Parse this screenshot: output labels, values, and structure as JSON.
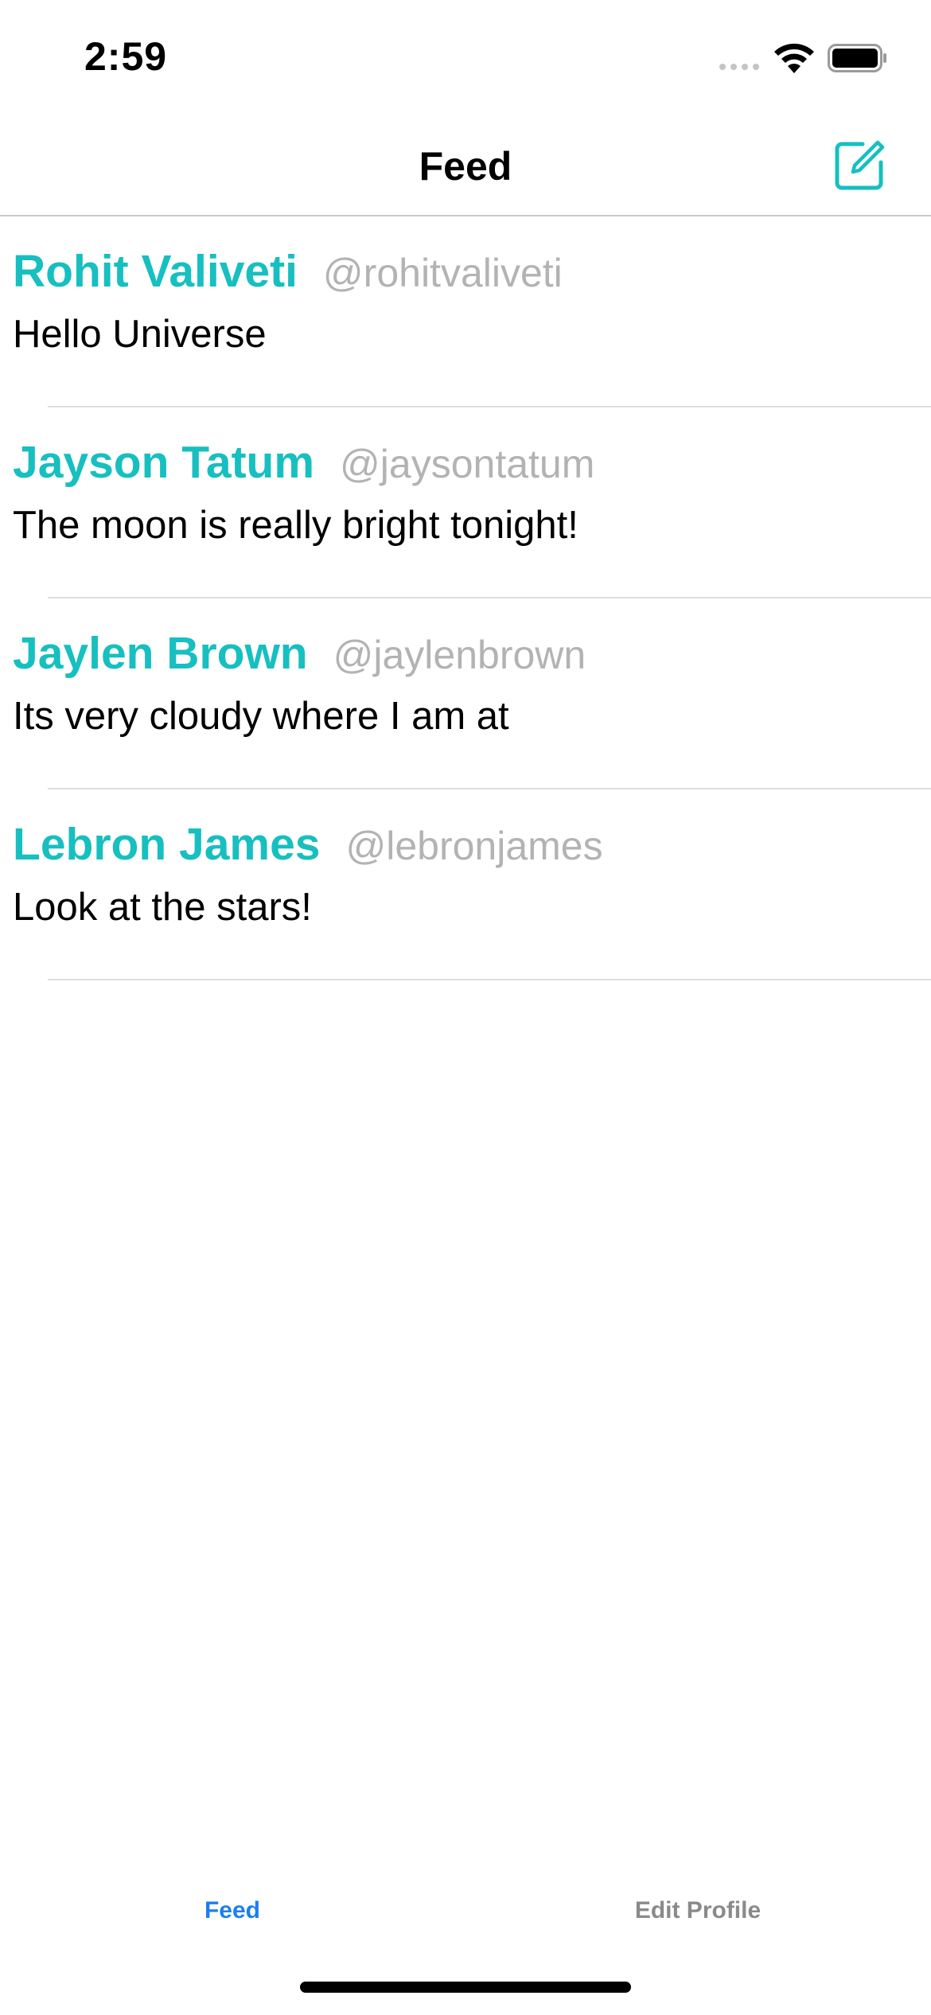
{
  "status_bar": {
    "time": "2:59",
    "icons": [
      "cellular-signal-icon",
      "wifi-icon",
      "battery-icon"
    ]
  },
  "nav": {
    "title": "Feed",
    "right_action_icon": "compose-icon"
  },
  "colors": {
    "accent": "#17bfc0",
    "tab_active": "#1d7ef0",
    "tab_inactive": "#8a8a8a",
    "username": "#b3b3b3"
  },
  "feed": [
    {
      "name": "Rohit Valiveti",
      "handle": "@rohitvaliveti",
      "text": "Hello Universe"
    },
    {
      "name": "Jayson Tatum",
      "handle": "@jaysontatum",
      "text": "The moon is really bright tonight!"
    },
    {
      "name": "Jaylen Brown",
      "handle": "@jaylenbrown",
      "text": "Its very cloudy where I am at"
    },
    {
      "name": "Lebron James",
      "handle": "@lebronjames",
      "text": "Look at the stars!"
    }
  ],
  "tabs": [
    {
      "label": "Feed",
      "active": true
    },
    {
      "label": "Edit Profile",
      "active": false
    }
  ]
}
